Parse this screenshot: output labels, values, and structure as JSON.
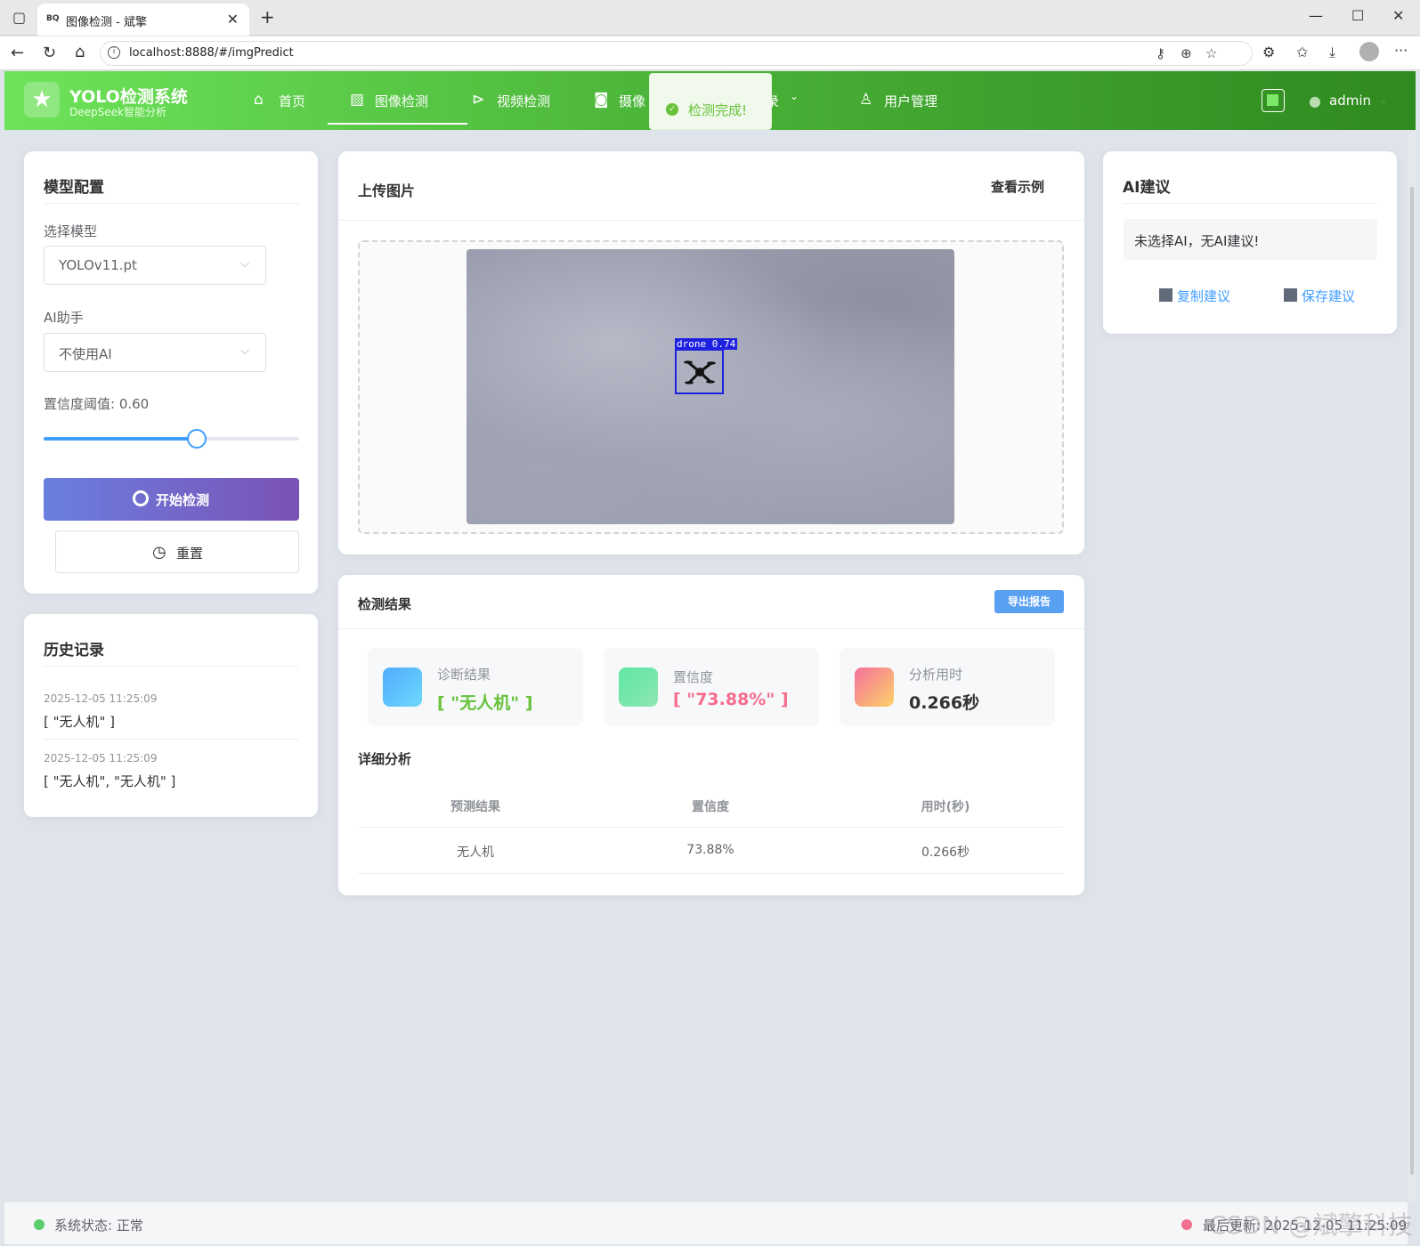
{
  "browser": {
    "tab_title": "图像检测 - 斌擎",
    "tab_favicon": "BQ",
    "url": "localhost:8888/#/imgPredict"
  },
  "header": {
    "logo_title": "YOLO检测系统",
    "logo_subtitle": "DeepSeek智能分析",
    "nav": [
      {
        "label": "首页",
        "icon": "home-icon"
      },
      {
        "label": "图像检测",
        "icon": "image-icon"
      },
      {
        "label": "视频检测",
        "icon": "play-icon"
      },
      {
        "label": "摄像",
        "icon": "camera-icon"
      },
      {
        "label": "记录",
        "icon": "chevron-down-icon"
      },
      {
        "label": "用户管理",
        "icon": "user-icon"
      }
    ],
    "active_nav": "图像检测",
    "user": "admin",
    "accent_color": "#4cb63a"
  },
  "toast": {
    "message": "检测完成!"
  },
  "model_config": {
    "title": "模型配置",
    "model_label": "选择模型",
    "model_value": "YOLOv11.pt",
    "ai_label": "AI助手",
    "ai_value": "不使用AI",
    "confidence_label": "置信度阈值: 0.60",
    "confidence_value": 0.6,
    "start_button": "开始检测",
    "reset_button": "重置"
  },
  "history": {
    "title": "历史记录",
    "items": [
      {
        "time": "2025-12-05 11:25:09",
        "value": "[ \"无人机\" ]"
      },
      {
        "time": "2025-12-05 11:25:09",
        "value": "[ \"无人机\", \"无人机\" ]"
      }
    ]
  },
  "upload": {
    "title": "上传图片",
    "example_link": "查看示例",
    "detection_label": "drone 0.74"
  },
  "results": {
    "title": "检测结果",
    "export_button": "导出报告",
    "stats": [
      {
        "label": "诊断结果",
        "value": "[ \"无人机\" ]",
        "color": "#67c23a"
      },
      {
        "label": "置信度",
        "value": "[ \"73.88%\" ]",
        "color": "#f56c8c"
      },
      {
        "label": "分析用时",
        "value": "0.266秒",
        "color": "#303133"
      }
    ],
    "detail_title": "详细分析",
    "table_headers": [
      "预测结果",
      "置信度",
      "用时(秒)"
    ],
    "table_rows": [
      [
        "无人机",
        "73.88%",
        "0.266秒"
      ]
    ]
  },
  "ai_advice": {
    "title": "AI建议",
    "message": "未选择AI，无AI建议!",
    "copy_button": "复制建议",
    "save_button": "保存建议"
  },
  "footer": {
    "status": "系统状态: 正常",
    "last_update": "最后更新: 2025-12-05 11:25:09",
    "watermark": "CSDN @斌擎科技"
  }
}
